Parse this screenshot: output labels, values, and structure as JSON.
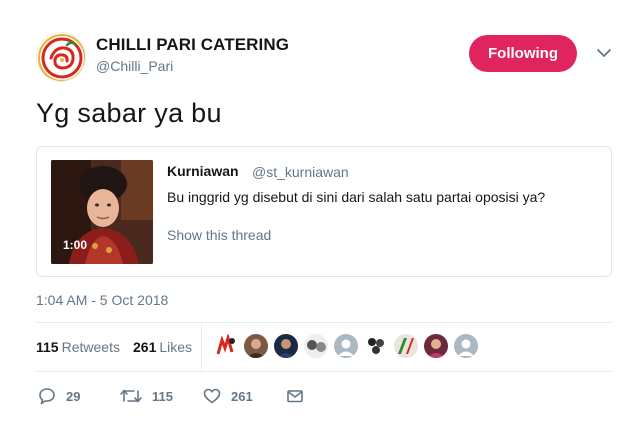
{
  "author": {
    "display_name": "CHILLI PARI CATERING",
    "handle": "@Chilli_Pari",
    "follow_label": "Following"
  },
  "tweet": {
    "text": "Yg sabar ya bu",
    "timestamp": "1:04 AM - 5 Oct 2018"
  },
  "quoted": {
    "name": "Kurniawan",
    "handle": "@st_kurniawan",
    "text": "Bu inggrid yg disebut di sini dari salah satu partai oposisi ya?",
    "thread_link": "Show this thread",
    "video_duration": "1:00"
  },
  "stats": {
    "retweets_count": "115",
    "retweets_label": "Retweets",
    "likes_count": "261",
    "likes_label": "Likes"
  },
  "actions": {
    "reply_count": "29",
    "retweet_count": "115",
    "like_count": "261"
  },
  "colors": {
    "follow_button": "#e0245e",
    "secondary_text": "#657786",
    "border": "#e1e8ed"
  },
  "icons": [
    "chevron-down-icon",
    "reply-icon",
    "retweet-icon",
    "heart-icon",
    "mail-icon"
  ]
}
